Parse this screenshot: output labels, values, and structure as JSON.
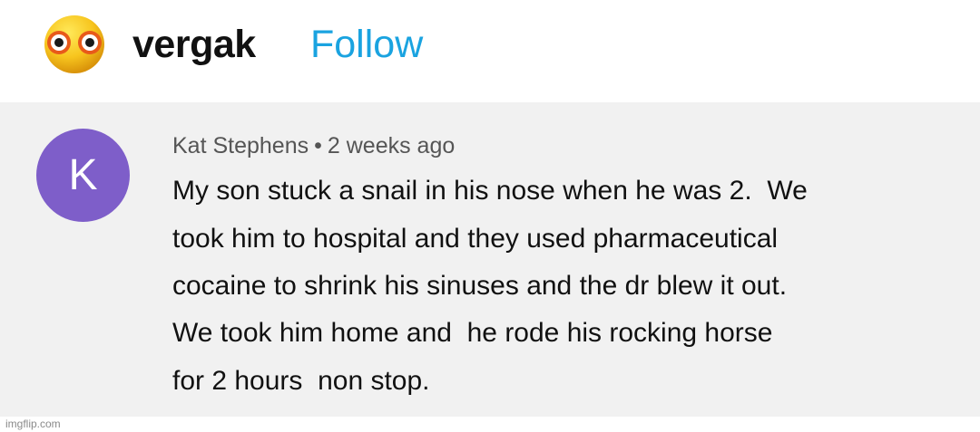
{
  "post_header": {
    "logo_icon": "surprised-emoji-icon",
    "username": "vergak",
    "follow_label": "Follow",
    "follow_color": "#1aa3e0"
  },
  "comment": {
    "avatar_letter": "K",
    "avatar_color": "#7e5ec9",
    "author": "Kat Stephens",
    "separator": "•",
    "time": "2 weeks ago",
    "lines": [
      "My son stuck a snail in his nose when he was 2.  We",
      "took him to hospital and they used pharmaceutical",
      "cocaine to shrink his sinuses and the dr blew it out.",
      "We took him home and  he rode his rocking horse",
      "for 2 hours  non stop."
    ]
  },
  "watermark": "imgflip.com"
}
